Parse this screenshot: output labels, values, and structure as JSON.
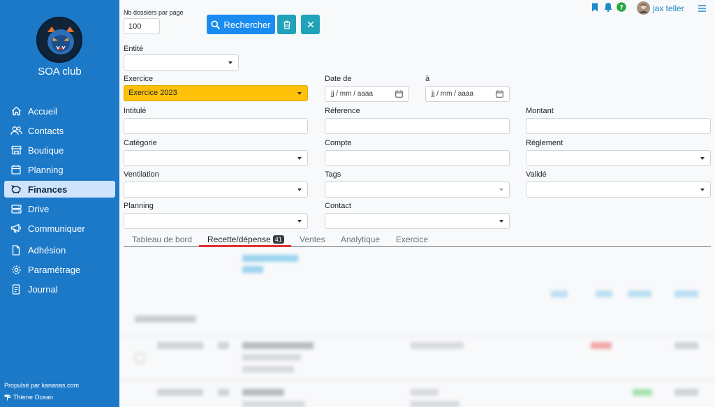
{
  "sidebar": {
    "club_name": "SOA club",
    "items": [
      {
        "label": "Accueil",
        "icon": "home-icon"
      },
      {
        "label": "Contacts",
        "icon": "users-icon"
      },
      {
        "label": "Boutique",
        "icon": "shop-icon"
      },
      {
        "label": "Planning",
        "icon": "calendar-icon"
      },
      {
        "label": "Finances",
        "icon": "piggy-bank-icon",
        "active": true
      },
      {
        "label": "Drive",
        "icon": "drive-icon"
      },
      {
        "label": "Communiquer",
        "icon": "megaphone-icon"
      },
      {
        "label": "Adhésion",
        "icon": "document-icon"
      },
      {
        "label": "Paramétrage",
        "icon": "gear-icon"
      },
      {
        "label": "Journal",
        "icon": "journal-icon"
      }
    ],
    "powered_by": "Propulsé par kananas.com",
    "theme": "Thème Ocean"
  },
  "header": {
    "user_name": "jax teller"
  },
  "filters": {
    "per_page_label": "Nb dossiers par page",
    "per_page_value": "100",
    "search_label": "Rechercher",
    "entity_label": "Entité",
    "exercise_label": "Exercice",
    "exercise_value": "Exercice 2023",
    "date_from_label": "Date de",
    "date_to_label": "à",
    "date_placeholder": "jj / mm / aaaa",
    "title_label": "Intitulé",
    "reference_label": "Réference",
    "amount_label": "Montant",
    "category_label": "Catégorie",
    "account_label": "Compte",
    "payment_label": "Règlement",
    "ventilation_label": "Ventilation",
    "tags_label": "Tags",
    "validated_label": "Validé",
    "planning_label": "Planning",
    "contact_label": "Contact"
  },
  "tabs": [
    {
      "label": "Tableau de bord"
    },
    {
      "label": "Recette/dépense",
      "badge": "41",
      "active": true
    },
    {
      "label": "Ventes"
    },
    {
      "label": "Analytique"
    },
    {
      "label": "Exercice"
    }
  ],
  "colors": {
    "sidebar": "#1b79c8",
    "primary": "#1a8cf0",
    "info": "#20a3b8",
    "exercise": "#ffc107",
    "active_tab": "#e03131"
  }
}
